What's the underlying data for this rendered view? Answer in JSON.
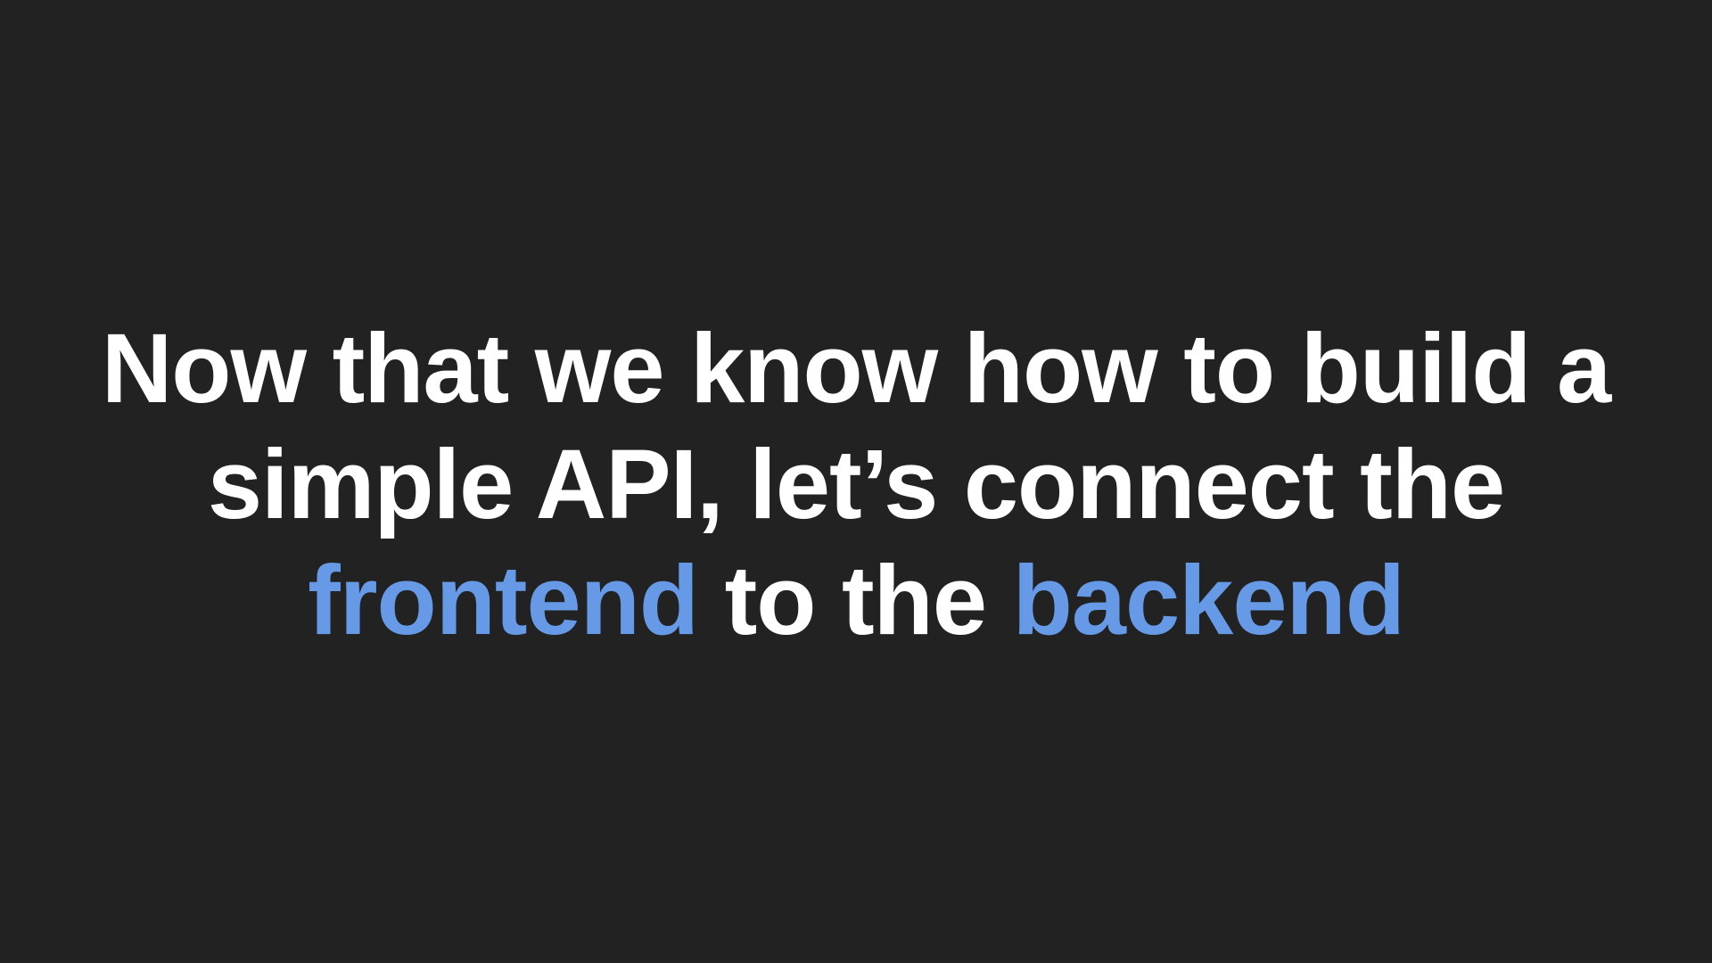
{
  "slide": {
    "line1": "Now that we know how to build a",
    "line2": "simple API, let’s connect the",
    "line3": {
      "word1": "frontend",
      "middle": " to the ",
      "word2": "backend"
    }
  },
  "colors": {
    "background": "#222222",
    "text": "#ffffff",
    "accent": "#6699e6"
  }
}
